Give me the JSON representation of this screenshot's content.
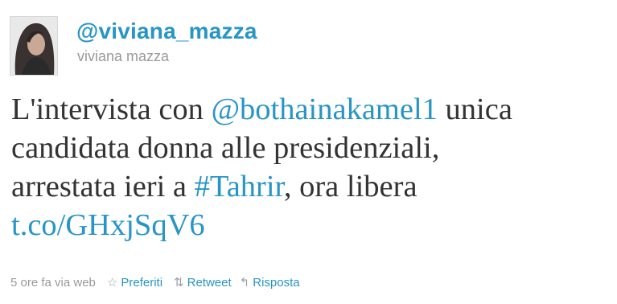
{
  "author": {
    "handle": "@viviana_mazza",
    "name": "viviana mazza",
    "avatar_icon": "profile-photo"
  },
  "tweet": {
    "line1_text": "L'intervista con ",
    "mention": "@bothainakamel1",
    "line1_tail": " unica",
    "line2": "candidata donna alle presidenziali,",
    "line3_text": "arrestata ieri a ",
    "hashtag": "#Tahrir",
    "line3_tail": ", ora libera",
    "link": "t.co/GHxjSqV6"
  },
  "meta": {
    "timestamp": "5 ore fa via web",
    "favorite_label": "Preferiti",
    "retweet_label": "Retweet",
    "reply_label": "Risposta",
    "favorite_icon": "star-icon",
    "retweet_icon": "retweet-icon",
    "reply_icon": "reply-arrow-icon"
  },
  "colors": {
    "link": "#2795c5",
    "text": "#333333",
    "muted": "#999999"
  }
}
